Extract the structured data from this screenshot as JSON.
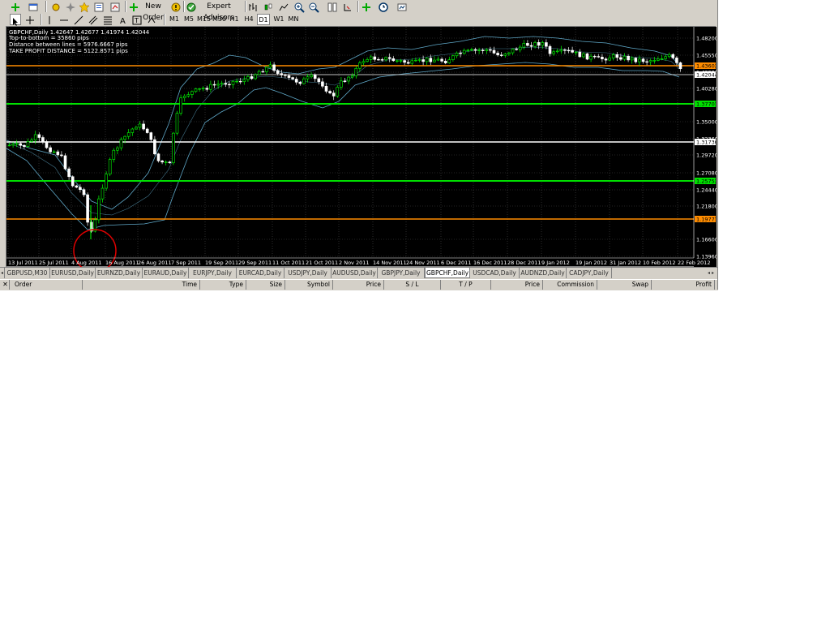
{
  "toolbar": {
    "new_order_label": "New Order",
    "expert_advisors_label": "Expert Advisors",
    "timeframes": [
      "M1",
      "M5",
      "M15",
      "M30",
      "H1",
      "H4",
      "D1",
      "W1",
      "MN"
    ],
    "active_timeframe": "D1"
  },
  "chart": {
    "symbol_line": "GBPCHF,Daily  1.42647 1.42677 1.41974 1.42044",
    "info_lines": [
      "Top-to-bottom = 35860 pips",
      "Distance between lines = 5976.6667 pips",
      "TAKE PROFIT DISTANCE = 5122.8571 pips"
    ],
    "price_labels": [
      "1.48200",
      "1.45550",
      "1.42920",
      "1.40280",
      "1.35000",
      "1.32360",
      "1.29720",
      "1.27080",
      "1.24440",
      "1.21800",
      "1.16600",
      "1.13960"
    ],
    "level_labels": [
      {
        "text": "1.43603",
        "color": "#ff8c00"
      },
      {
        "text": "1.42044",
        "color": "#ffffff"
      },
      {
        "text": "1.37707",
        "color": "#00e000"
      },
      {
        "text": "1.31730",
        "color": "#ffffff"
      },
      {
        "text": "1.25753",
        "color": "#00e000"
      },
      {
        "text": "1.19777",
        "color": "#ff8c00"
      }
    ],
    "date_labels": [
      "13 Jul 2011",
      "25 Jul 2011",
      "4 Aug 2011",
      "16 Aug 2011",
      "26 Aug 2011",
      "7 Sep 2011",
      "19 Sep 2011",
      "29 Sep 2011",
      "11 Oct 2011",
      "21 Oct 2011",
      "2 Nov 2011",
      "14 Nov 2011",
      "24 Nov 2011",
      "6 Dec 2011",
      "16 Dec 2011",
      "28 Dec 2011",
      "9 Jan 2012",
      "19 Jan 2012",
      "31 Jan 2012",
      "10 Feb 2012",
      "22 Feb 2012"
    ]
  },
  "tabs": [
    "GBPUSD,M30",
    "EURUSD,Daily",
    "EURNZD,Daily",
    "EURAUD,Daily",
    "EURJPY,Daily",
    "EURCAD,Daily",
    "USDJPY,Daily",
    "AUDUSD,Daily",
    "GBPJPY,Daily",
    "GBPCHF,Daily",
    "USDCAD,Daily",
    "AUDNZD,Daily",
    "CADJPY,Daily"
  ],
  "active_tab": "GBPCHF,Daily",
  "terminal_columns": [
    "Order",
    "Time",
    "Type",
    "Size",
    "Symbol",
    "Price",
    "S / L",
    "T / P",
    "Price",
    "Commission",
    "Swap",
    "Profit"
  ],
  "colors": {
    "bull": "#00ff00",
    "bear": "#ffffff",
    "bands": "#5fa8c8",
    "grid": "#4a4a4a",
    "circle": "#e00000"
  }
}
